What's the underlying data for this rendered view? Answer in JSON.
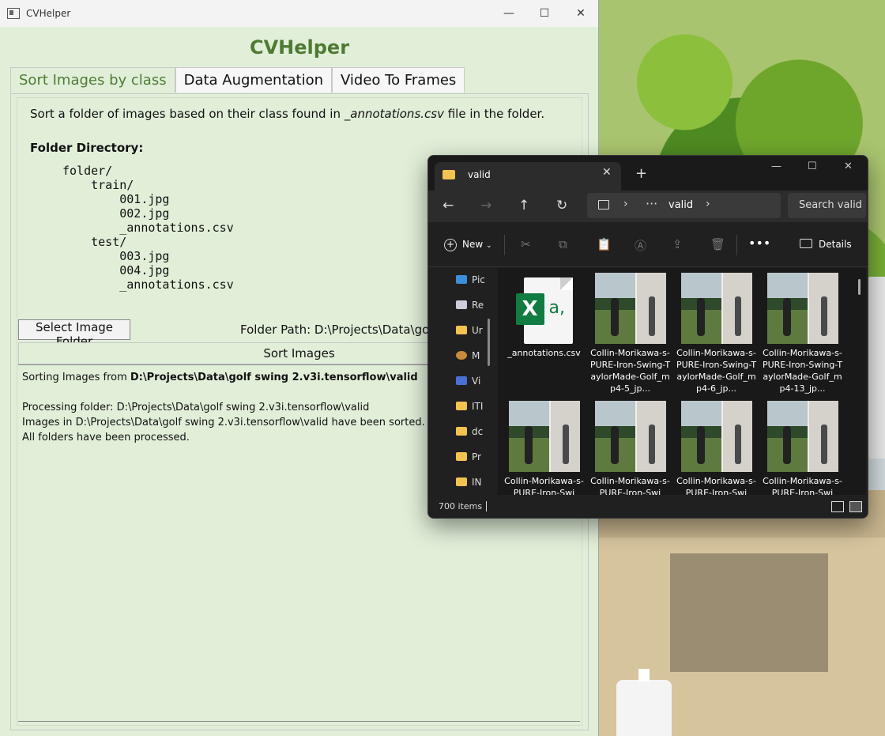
{
  "cvhelper": {
    "window_title": "CVHelper",
    "heading": "CVHelper",
    "tabs": [
      "Sort Images by class",
      "Data Augmentation",
      "Video To Frames"
    ],
    "description_prefix": "Sort a folder of images based on their class found in ",
    "description_file": "_annotations.csv",
    "description_suffix": " file in the folder.",
    "folder_dir_title": "Folder Directory:",
    "folder_tree": "folder/\n    train/\n        001.jpg\n        002.jpg\n        _annotations.csv\n    test/\n        003.jpg\n        004.jpg\n        _annotations.csv",
    "select_button": "Select Image Folder",
    "folder_path_label": "Folder Path: D:\\Projects\\Data\\golf",
    "sort_button": "Sort Images",
    "log": {
      "sorting_prefix": "Sorting Images from ",
      "sorting_path": "D:\\Projects\\Data\\golf swing 2.v3i.tensorflow\\valid",
      "line2": "Processing folder: D:\\Projects\\Data\\golf swing 2.v3i.tensorflow\\valid",
      "line3": "Images in D:\\Projects\\Data\\golf swing 2.v3i.tensorflow\\valid have been sorted.",
      "line4": "All folders have been processed."
    },
    "controls": {
      "minimize": "—",
      "maximize": "☐",
      "close": "✕"
    }
  },
  "explorer": {
    "tab_title": "valid",
    "tab_close": "✕",
    "new_tab": "+",
    "address": {
      "current": "valid",
      "overflow": "···"
    },
    "search_placeholder": "Search valid",
    "toolbar": {
      "new_label": "New",
      "more": "•••",
      "details_label": "Details"
    },
    "sidebar_items": [
      "Pic",
      "Re",
      "Ur",
      "M",
      "Vi",
      "ITI",
      "dc",
      "Pr",
      "IN"
    ],
    "files": [
      {
        "name": "_annotations.csv",
        "type": "excel"
      },
      {
        "name": "Collin-Morikawa-s-PURE-Iron-Swing-TaylorMade-Golf_mp4-5_jp...",
        "type": "image"
      },
      {
        "name": "Collin-Morikawa-s-PURE-Iron-Swing-TaylorMade-Golf_mp4-6_jp...",
        "type": "image"
      },
      {
        "name": "Collin-Morikawa-s-PURE-Iron-Swing-TaylorMade-Golf_mp4-13_jp...",
        "type": "image"
      },
      {
        "name": "Collin-Morikawa-s-PURE-Iron-Swi",
        "type": "image"
      },
      {
        "name": "Collin-Morikawa-s-PURE-Iron-Swi",
        "type": "image"
      },
      {
        "name": "Collin-Morikawa-s-PURE-Iron-Swi",
        "type": "image"
      },
      {
        "name": "Collin-Morikawa-s-PURE-Iron-Swi",
        "type": "image"
      }
    ],
    "status": "700 items"
  }
}
